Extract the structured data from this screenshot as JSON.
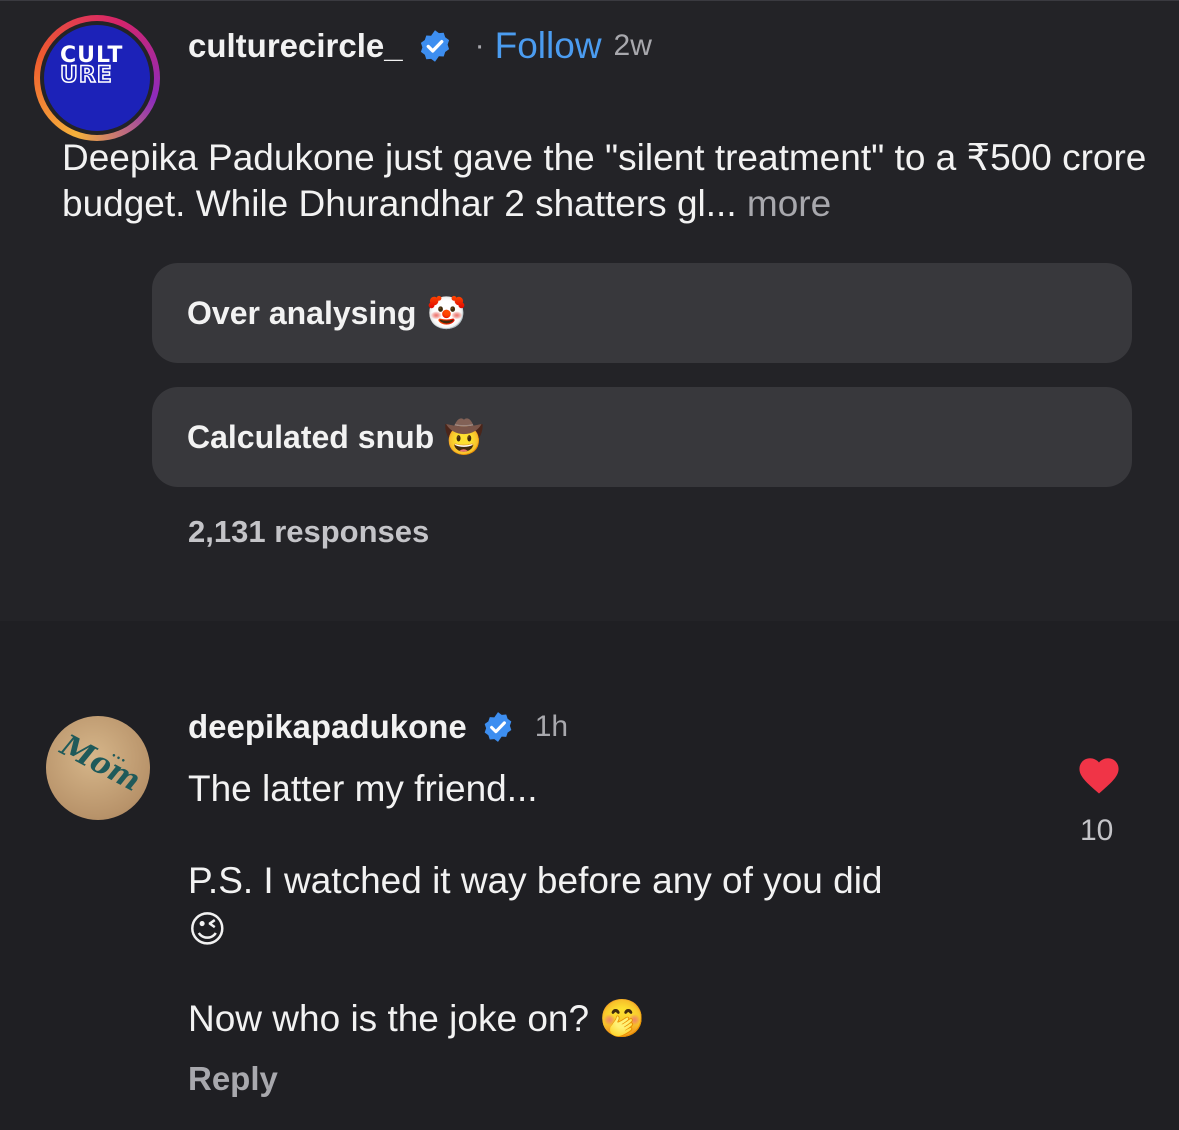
{
  "post": {
    "username": "culturecircle_",
    "follow_label": "Follow",
    "dot": "·",
    "time": "2w",
    "avatar_logo_top": "CULT",
    "avatar_logo_bottom": "URE",
    "caption": "Deepika Padukone just gave the \"silent treatment\" to a ₹500 crore budget. While Dhurandhar 2 shatters gl...",
    "more_label": "more",
    "poll": {
      "options": [
        {
          "label": "Over analysing",
          "emoji": "🤡"
        },
        {
          "label": "Calculated snub",
          "emoji": "🤠"
        }
      ],
      "responses": "2,131 responses"
    }
  },
  "comment": {
    "username": "deepikapadukone",
    "time": "1h",
    "lines": [
      "The latter my friend...",
      "P.S. I watched it way before any of you did",
      "😉",
      "Now who is the joke on? 🤭"
    ],
    "reply_label": "Reply",
    "like_count": "10"
  },
  "colors": {
    "background": "#1f1f23",
    "follow_blue": "#4b9cf0",
    "verified_blue": "#3d8ef0",
    "heart_red": "#f03447",
    "poll_option_bg": "#38383c"
  },
  "icons": {
    "verified": "verified-badge-icon",
    "heart": "heart-icon"
  }
}
